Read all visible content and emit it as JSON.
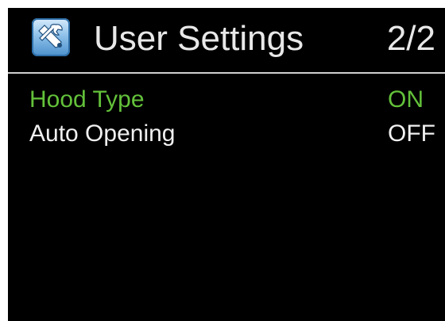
{
  "header": {
    "icon": "tools-icon",
    "title": "User Settings",
    "page_indicator": "2/2"
  },
  "settings": {
    "items": [
      {
        "label": "Hood Type",
        "value": "ON",
        "selected": true
      },
      {
        "label": "Auto Opening",
        "value": "OFF",
        "selected": false
      }
    ]
  },
  "colors": {
    "background": "#000000",
    "text": "#f0f0f0",
    "selected": "#63c13a",
    "divider": "#cfcfcf"
  }
}
